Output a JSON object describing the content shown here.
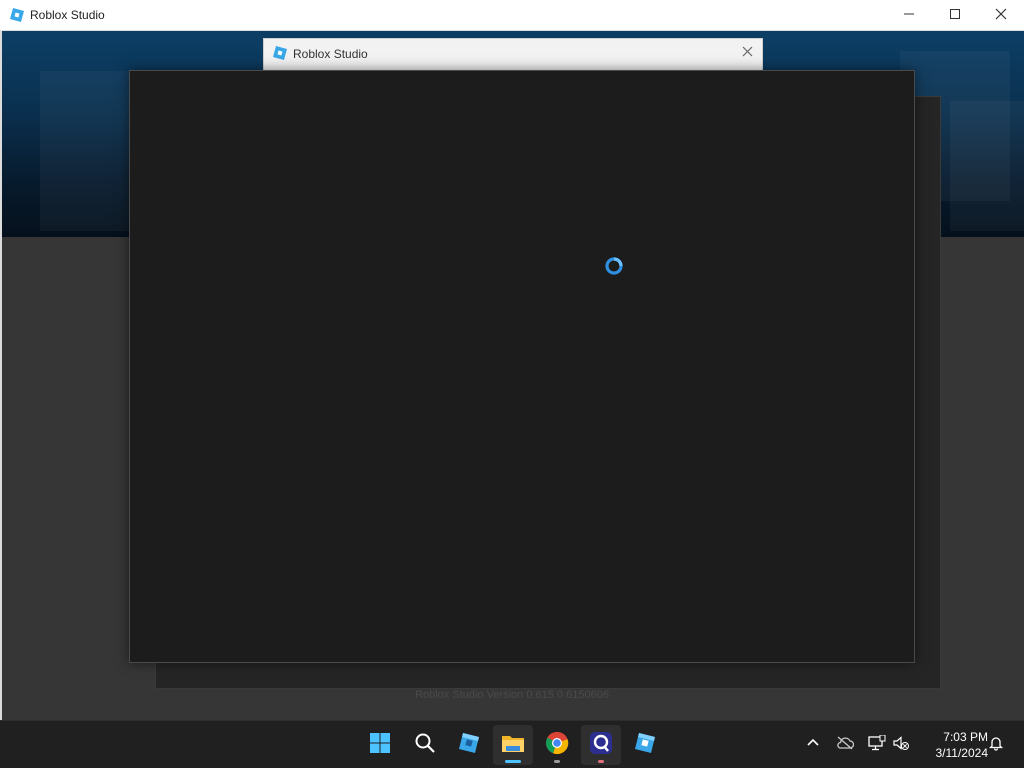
{
  "main_window": {
    "title": "Roblox Studio",
    "controls": {
      "minimize": "minimize-icon",
      "maximize": "maximize-icon",
      "close": "close-icon"
    }
  },
  "secondary_window": {
    "title": "Roblox Studio"
  },
  "loader": {
    "version_text": "Roblox Studio Version 0.615.0.6150606",
    "spinner_color": "#2f8fe0"
  },
  "taskbar": {
    "apps": [
      {
        "name": "start",
        "icon": "windows-icon"
      },
      {
        "name": "search",
        "icon": "search-icon"
      },
      {
        "name": "roblox",
        "icon": "roblox-icon"
      },
      {
        "name": "file-explorer",
        "icon": "folder-icon",
        "active": true
      },
      {
        "name": "chrome",
        "icon": "chrome-icon"
      },
      {
        "name": "app",
        "icon": "app-icon",
        "active": true
      },
      {
        "name": "roblox-studio",
        "icon": "roblox-studio-icon"
      }
    ],
    "tray": [
      "chevron-up-icon",
      "cloud-offline-icon",
      "network-icon",
      "volume-muted-icon"
    ],
    "clock": {
      "time": "7:03 PM",
      "date": "3/11/2024"
    }
  },
  "colors": {
    "accent": "#4cc2ff",
    "roblox_blue": "#3aa7e8",
    "dialog_bg": "#1c1c1c"
  }
}
